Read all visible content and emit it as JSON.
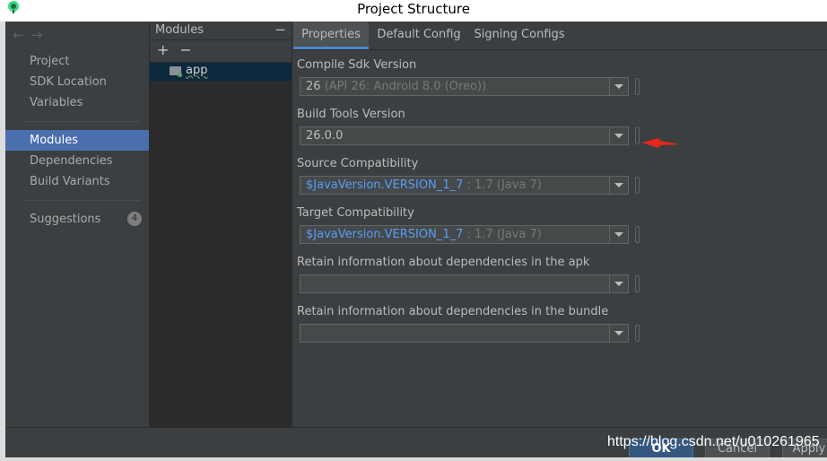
{
  "window": {
    "title": "Project Structure"
  },
  "nav": {
    "items": [
      {
        "label": "Project"
      },
      {
        "label": "SDK Location"
      },
      {
        "label": "Variables"
      },
      {
        "label": "Modules"
      },
      {
        "label": "Dependencies"
      },
      {
        "label": "Build Variants"
      },
      {
        "label": "Suggestions",
        "badge": "4"
      }
    ],
    "selected": "Modules"
  },
  "modules": {
    "header": "Modules",
    "add": "+",
    "remove": "−",
    "collapse": "−",
    "items": [
      {
        "name": "app"
      }
    ]
  },
  "tabs": [
    {
      "label": "Properties",
      "active": true
    },
    {
      "label": "Default Config"
    },
    {
      "label": "Signing Configs"
    }
  ],
  "fields": {
    "compile_sdk": {
      "label": "Compile Sdk Version",
      "value": "26",
      "hint": "(API 26: Android 8.0 (Oreo))"
    },
    "build_tools": {
      "label": "Build Tools Version",
      "value": "26.0.0"
    },
    "source_compat": {
      "label": "Source Compatibility",
      "ref": "$JavaVersion.VERSION_1_7",
      "hint": ": 1.7 (Java 7)"
    },
    "target_compat": {
      "label": "Target Compatibility",
      "ref": "$JavaVersion.VERSION_1_7",
      "hint": ": 1.7 (Java 7)"
    },
    "deps_apk": {
      "label": "Retain information about dependencies in the apk",
      "value": ""
    },
    "deps_bundle": {
      "label": "Retain information about dependencies in the bundle",
      "value": ""
    }
  },
  "footer": {
    "ok": "OK",
    "cancel": "Cancel",
    "apply": "Apply"
  },
  "watermark": "https://blog.csdn.net/u010261965",
  "colors": {
    "accent": "#4b6eaf",
    "tab_underline": "#4a88c7",
    "arrow": "#e8261c"
  }
}
